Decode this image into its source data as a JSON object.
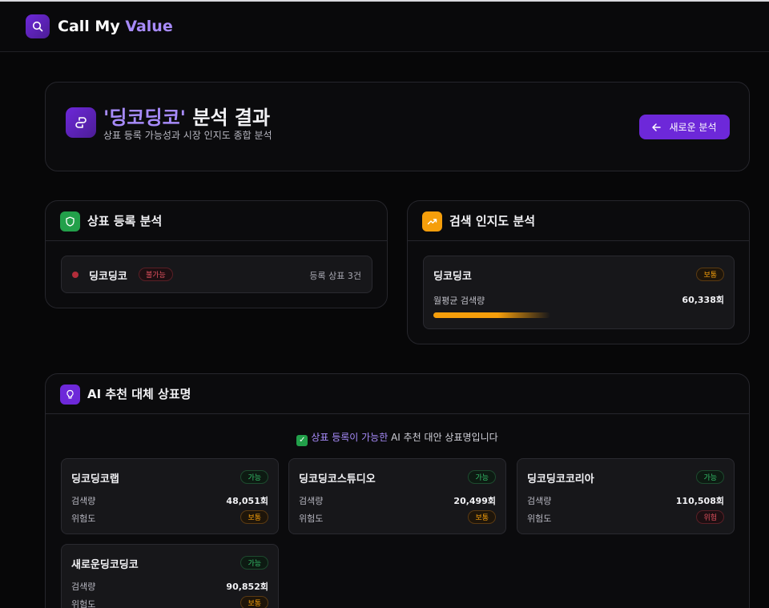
{
  "app": {
    "name_prefix": "Call My ",
    "name_accent": "Value"
  },
  "hero": {
    "query": "'딩코딩코'",
    "title_suffix": " 분석 결과",
    "subtitle": "상표 등록 가능성과 시장 인지도 종합 분석",
    "button_label": "새로운 분석"
  },
  "trademark": {
    "title": "상표 등록 분석",
    "name": "딩코딩코",
    "status": "불가능",
    "status_color": "#e0505e",
    "count_text": "등록 상표 3건"
  },
  "search": {
    "title": "검색 인지도 분석",
    "name": "딩코딩코",
    "level": "보통",
    "metric_label": "월평균 검색량",
    "metric_value": "60,338회",
    "bar_fraction": 0.4
  },
  "ai": {
    "title": "AI 추천 대체 상표명",
    "note_highlight": "상표 등록이 가능한",
    "note_rest": " AI 추천 대안 상표명입니다",
    "volume_label": "검색량",
    "risk_label": "위험도",
    "suggestions": [
      {
        "name": "딩코딩코랩",
        "status": "가능",
        "volume": "48,051회",
        "risk": "보통"
      },
      {
        "name": "딩코딩코스튜디오",
        "status": "가능",
        "volume": "20,499회",
        "risk": "보통"
      },
      {
        "name": "딩코딩코코리아",
        "status": "가능",
        "volume": "110,508회",
        "risk": "위험"
      },
      {
        "name": "새로운딩코딩코",
        "status": "가능",
        "volume": "90,852회",
        "risk": "보통"
      }
    ]
  },
  "colors": {
    "accent": "#6d28d9",
    "accent_text": "#a78bfa",
    "green": "#22a04a",
    "orange": "#f59e0b",
    "red": "#e0505e"
  }
}
